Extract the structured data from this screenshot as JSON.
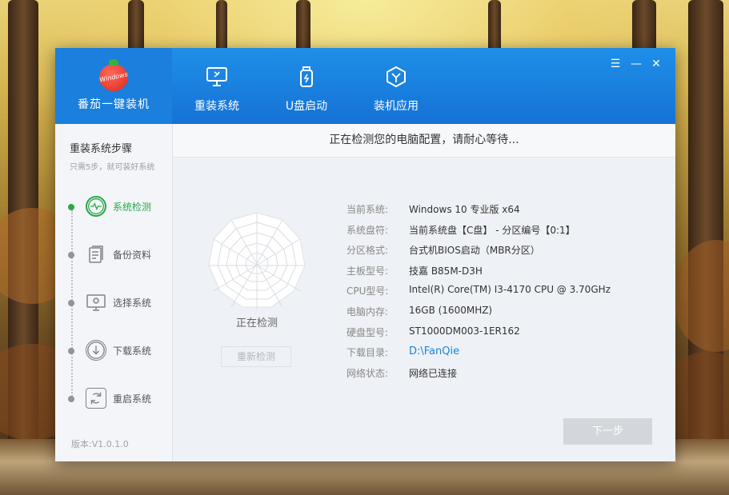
{
  "app": {
    "brand_logo_text": "Windows",
    "brand_name": "番茄一键装机"
  },
  "tabs": [
    {
      "label": "重装系统",
      "icon": "monitor-repair-icon"
    },
    {
      "label": "U盘启动",
      "icon": "usb-drive-icon"
    },
    {
      "label": "装机应用",
      "icon": "app-hexagon-icon"
    }
  ],
  "window_controls": {
    "menu": "☰",
    "minimize": "—",
    "close": "✕"
  },
  "sidebar": {
    "title": "重装系统步骤",
    "subtitle": "只需5步，就可装好系统",
    "steps": [
      {
        "label": "系统检测",
        "icon": "system-check-icon",
        "active": true
      },
      {
        "label": "备份资料",
        "icon": "backup-icon",
        "active": false
      },
      {
        "label": "选择系统",
        "icon": "select-system-icon",
        "active": false
      },
      {
        "label": "下载系统",
        "icon": "download-icon",
        "active": false
      },
      {
        "label": "重启系统",
        "icon": "restart-icon",
        "active": false
      }
    ],
    "version": "版本:V1.0.1.0"
  },
  "main": {
    "header": "正在检测您的电脑配置，请耐心等待...",
    "detecting_label": "正在检测",
    "recheck_label": "重新检测",
    "info": [
      {
        "key": "当前系统:",
        "value": "Windows  10  专业版 x64"
      },
      {
        "key": "系统盘符:",
        "value": "当前系统盘【C盘】 - 分区编号【0:1】"
      },
      {
        "key": "分区格式:",
        "value": "台式机BIOS启动（MBR分区）"
      },
      {
        "key": "主板型号:",
        "value": "技嘉 B85M-D3H"
      },
      {
        "key": "CPU型号:",
        "value": "Intel(R) Core(TM) I3-4170 CPU @ 3.70GHz"
      },
      {
        "key": "电脑内存:",
        "value": "16GB (1600MHZ)"
      },
      {
        "key": "硬盘型号:",
        "value": "ST1000DM003-1ER162"
      },
      {
        "key": "下载目录:",
        "value": "D:\\FanQie",
        "link": true
      },
      {
        "key": "网络状态:",
        "value": "网络已连接"
      }
    ],
    "next_label": "下一步"
  },
  "colors": {
    "accent_blue": "#1a7fdd",
    "active_green": "#2ba84a",
    "link_blue": "#1a84d9"
  }
}
